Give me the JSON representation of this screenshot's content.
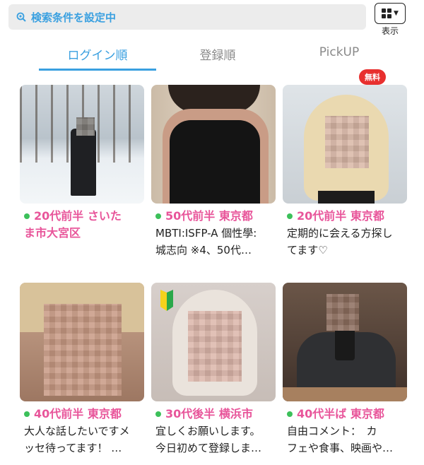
{
  "search": {
    "label": "検索条件を設定中"
  },
  "view_toggle": {
    "label": "表示"
  },
  "tabs": [
    {
      "label": "ログイン順",
      "active": true
    },
    {
      "label": "登録順",
      "active": false
    },
    {
      "label": "PickUP",
      "active": false,
      "badge": "無料"
    }
  ],
  "colors": {
    "accent": "#3aa0e0",
    "age_text": "#e8559a",
    "online_dot": "#3cc05a",
    "badge": "#e8302f"
  },
  "cards": [
    {
      "age_area": "20代前半 さいた",
      "line2": "ま市大宮区",
      "desc": ""
    },
    {
      "age_area": "50代前半 東京都",
      "line2": "",
      "desc": "MBTI:ISFP-A 個性學:",
      "desc2": "城志向 ※4、50代…"
    },
    {
      "age_area": "20代前半 東京都",
      "line2": "",
      "desc": "定期的に会える方探し",
      "desc2": "てます♡"
    },
    {
      "age_area": "40代前半 東京都",
      "line2": "",
      "desc": "大人な話したいですメ",
      "desc2": "ッセ待ってます！ …"
    },
    {
      "age_area": "30代後半 横浜市",
      "line2": "",
      "desc": "宜しくお願いします。",
      "desc2": "今日初めて登録しま…",
      "beginner": true
    },
    {
      "age_area": "40代半ば 東京都",
      "line2": "",
      "desc": "自由コメント：　カ",
      "desc2": "フェや食事、映画や…"
    }
  ]
}
